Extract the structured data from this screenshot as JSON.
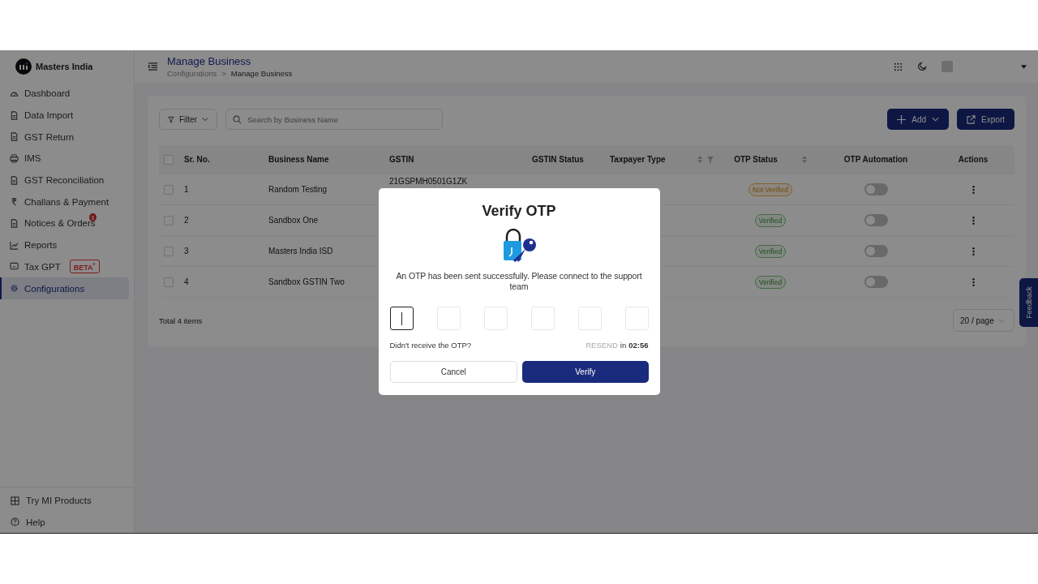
{
  "brand": {
    "name": "Masters India"
  },
  "sidebar": {
    "items": [
      {
        "label": "Dashboard",
        "selected": false
      },
      {
        "label": "Data Import",
        "selected": false
      },
      {
        "label": "GST Return",
        "selected": false
      },
      {
        "label": "IMS",
        "selected": false
      },
      {
        "label": "GST Reconciliation",
        "selected": false
      },
      {
        "label": "Challans & Payment",
        "selected": false
      },
      {
        "label": "Notices & Orders",
        "selected": false,
        "badge": "6"
      },
      {
        "label": "Reports",
        "selected": false
      },
      {
        "label": "Tax GPT",
        "selected": false,
        "tag": "BETA",
        "tag_mark": "*"
      },
      {
        "label": "Configurations",
        "selected": true
      }
    ],
    "footer": [
      {
        "label": "Try MI Products"
      },
      {
        "label": "Help"
      }
    ]
  },
  "header": {
    "title": "Manage Business",
    "breadcrumb": [
      "Configurations",
      "Manage Business"
    ],
    "breadcrumb_separator": ">"
  },
  "toolbar": {
    "filter": "Filter",
    "search": {
      "placeholder": "Search by Business Name"
    },
    "buttons": [
      "Add",
      "Export"
    ]
  },
  "table": {
    "all_checked": false,
    "columns": [
      {
        "label": "Sr. No.",
        "sortable": false,
        "filterable": false
      },
      {
        "label": "Business Name",
        "sortable": false,
        "filterable": false
      },
      {
        "label": "GSTIN",
        "sortable": false,
        "filterable": false
      },
      {
        "label": "GSTIN Status",
        "sortable": false,
        "filterable": false
      },
      {
        "label": "Taxpayer Type",
        "sortable": true,
        "filterable": true
      },
      {
        "label": "OTP Status",
        "sortable": true,
        "filterable": false
      },
      {
        "label": "OTP Automation",
        "sortable": false,
        "filterable": false
      },
      {
        "label": "Actions",
        "sortable": false,
        "filterable": false
      }
    ],
    "rows": [
      {
        "checked": false,
        "sr": "1",
        "name": "Random Testing",
        "gstin": "21GSPMH0501G1ZK",
        "otp_status": "Not Verified",
        "kind": "pending",
        "automation_on": false
      },
      {
        "checked": false,
        "sr": "2",
        "name": "Sandbox One",
        "otp_status": "Verified",
        "kind": "verified",
        "automation_on": false
      },
      {
        "checked": false,
        "sr": "3",
        "name": "Masters India ISD",
        "otp_status": "Verified",
        "kind": "verified",
        "automation_on": false
      },
      {
        "checked": false,
        "sr": "4",
        "name": "Sandbox GSTIN Two",
        "otp_status": "Verified",
        "kind": "verified",
        "automation_on": false
      }
    ],
    "total": "Total 4 items",
    "page_size": "20 / page"
  },
  "feedback": "Feedback",
  "dialog": {
    "title": "Verify OTP",
    "message": "An OTP has been sent successfully. Please connect to the support team",
    "digits": [
      {
        "focused": true
      },
      {
        "focused": false
      },
      {
        "focused": false
      },
      {
        "focused": false
      },
      {
        "focused": false
      },
      {
        "focused": false
      }
    ],
    "prompt": "Didn't receive the OTP?",
    "resend": "RESEND",
    "resend_suffix": "in",
    "timer": "02:56",
    "cancel": "Cancel",
    "confirm": "Verify"
  }
}
